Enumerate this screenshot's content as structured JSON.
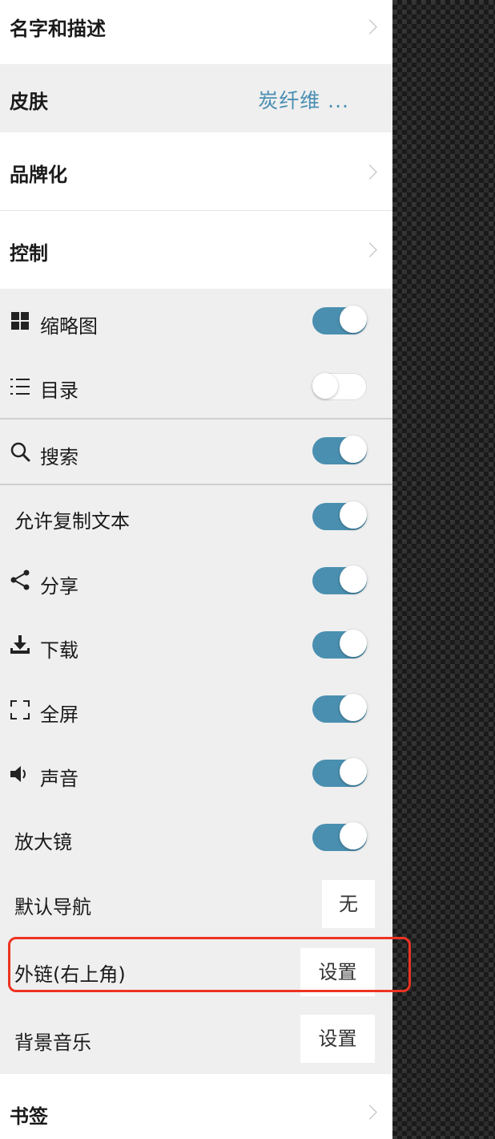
{
  "sections": {
    "name_desc": "名字和描述",
    "skin_label": "皮肤",
    "skin_value": "炭纤维 ...",
    "branding": "品牌化",
    "controls": "控制",
    "bookmarks": "书签"
  },
  "controls": {
    "thumbnails": {
      "label": "缩略图",
      "icon": "grid-icon",
      "on": true
    },
    "toc": {
      "label": "目录",
      "icon": "list-icon",
      "on": false
    },
    "search": {
      "label": "搜索",
      "icon": "search-icon",
      "on": true
    },
    "copy_text": {
      "label": "允许复制文本",
      "on": true
    },
    "share": {
      "label": "分享",
      "icon": "share-icon",
      "on": true
    },
    "download": {
      "label": "下载",
      "icon": "download-icon",
      "on": true
    },
    "fullscreen": {
      "label": "全屏",
      "icon": "fullscreen-icon",
      "on": true
    },
    "sound": {
      "label": "声音",
      "icon": "speaker-icon",
      "on": true
    },
    "magnifier": {
      "label": "放大镜",
      "on": true
    }
  },
  "default_nav": {
    "label": "默认导航",
    "value": "无"
  },
  "external_link": {
    "label": "外链(右上角)",
    "button": "设置"
  },
  "bg_music": {
    "label": "背景音乐",
    "button": "设置"
  },
  "colors": {
    "accent": "#4a8fb0",
    "skin_text": "#4a8fb2",
    "highlight": "#ee3322"
  }
}
